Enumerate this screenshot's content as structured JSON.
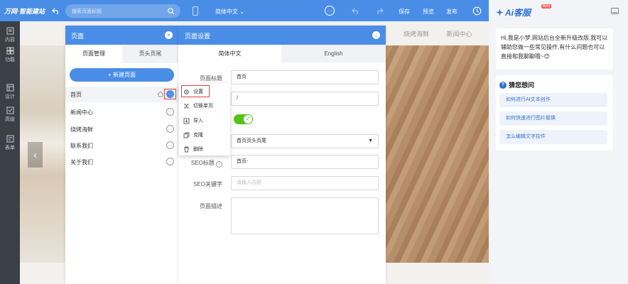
{
  "topbar": {
    "brand": "万网·智能建站",
    "search_placeholder": "搜索页面标题",
    "language": "简体中文",
    "save": "保存",
    "preview": "预览",
    "publish": "发布"
  },
  "sidenav": [
    {
      "label": "内容",
      "icon": "content-icon"
    },
    {
      "label": "功能",
      "icon": "function-icon"
    },
    {
      "label": "设计",
      "icon": "design-icon"
    },
    {
      "label": "高级",
      "icon": "advanced-icon"
    },
    {
      "label": "表单",
      "icon": "form-icon"
    }
  ],
  "site": {
    "nav": [
      "烧烤海鲜",
      "新闻中心"
    ]
  },
  "pages_panel": {
    "title": "页面",
    "tabs": [
      "页面管理",
      "页头页尾"
    ],
    "new_button": "+ 新建页面",
    "pages": [
      "首页",
      "新闻中心",
      "烧烤海鲜",
      "联系我们",
      "关于我们"
    ]
  },
  "context_menu": {
    "items": [
      "设置",
      "切换单页",
      "导入",
      "克隆",
      "删除"
    ]
  },
  "settings_panel": {
    "title": "页面设置",
    "lang_tabs": [
      "简体中文",
      "English"
    ],
    "page_title_label": "页面标题",
    "page_title_value": "首页",
    "field2_value": "/",
    "header_footer_value": "首页页头页尾",
    "seo_title_label": "SEO标题",
    "seo_title_value": "首页-",
    "seo_keywords_label": "SEO关键字",
    "seo_keywords_placeholder": "请输入内容",
    "page_desc_label": "页面描述"
  },
  "ai_panel": {
    "title": "Ai客服",
    "badge": "Beta",
    "greeting": "Hi,我是小梦,网站后台全新升级改版,我可以辅助您做一些常见操作,有什么问题也可以直接和我聊聊哦~😊",
    "guess_title": "猜您想问",
    "suggestions": [
      "如何进行AI文本创作",
      "如何快速进行图片替换",
      "怎么编辑文字控件"
    ]
  },
  "colors": {
    "primary": "#4a8de6",
    "sidebar": "#3b3f47",
    "highlight": "#e0403a",
    "toggle": "#52c41a"
  }
}
